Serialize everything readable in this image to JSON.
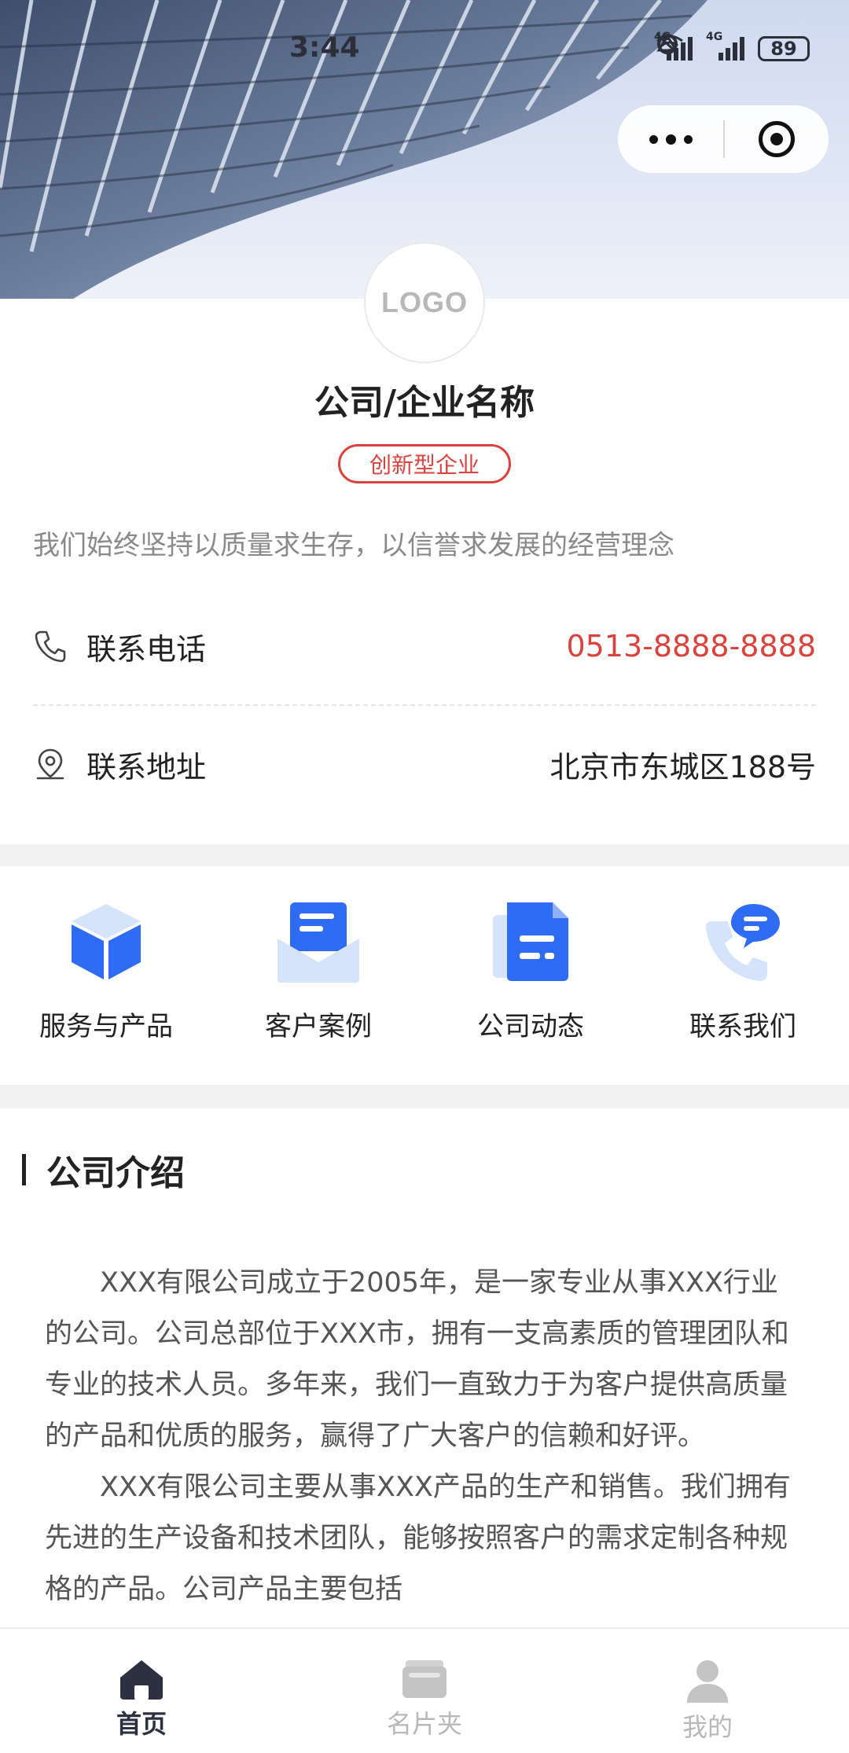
{
  "status_bar": {
    "time": "3:44",
    "battery": "89",
    "network_1": "4G",
    "network_2": "4G"
  },
  "mini_program_capsule": {
    "more_icon": "more-dots-icon",
    "close_icon": "target-close-icon"
  },
  "company": {
    "logo_text": "LOGO",
    "name": "公司/企业名称",
    "tag": "创新型企业",
    "slogan": "我们始终坚持以质量求生存，以信誉求发展的经营理念",
    "contacts": [
      {
        "icon": "phone-icon",
        "label": "联系电话",
        "value": "0513-8888-8888",
        "value_color": "#d9433e"
      },
      {
        "icon": "location-pin-icon",
        "label": "联系地址",
        "value": "北京市东城区188号",
        "value_color": "#222222"
      }
    ]
  },
  "quick_nav": [
    {
      "icon": "cube-icon",
      "label": "服务与产品"
    },
    {
      "icon": "envelope-icon",
      "label": "客户案例"
    },
    {
      "icon": "document-icon",
      "label": "公司动态"
    },
    {
      "icon": "phone-chat-icon",
      "label": "联系我们"
    }
  ],
  "intro": {
    "title": "公司介绍",
    "paragraphs": [
      "XXX有限公司成立于2005年，是一家专业从事XXX行业的公司。公司总部位于XXX市，拥有一支高素质的管理团队和专业的技术人员。多年来，我们一直致力于为客户提供高质量的产品和优质的服务，赢得了广大客户的信赖和好评。",
      "XXX有限公司主要从事XXX产品的生产和销售。我们拥有先进的生产设备和技术团队，能够按照客户的需求定制各种规格的产品。公司产品主要包括"
    ]
  },
  "tabbar": [
    {
      "icon": "home-icon",
      "label": "首页",
      "active": true
    },
    {
      "icon": "card-holder-icon",
      "label": "名片夹",
      "active": false
    },
    {
      "icon": "user-icon",
      "label": "我的",
      "active": false
    }
  ],
  "colors": {
    "accent_red": "#d9433e",
    "icon_blue": "#2f6cf6",
    "icon_light_blue": "#d6e4fb"
  }
}
